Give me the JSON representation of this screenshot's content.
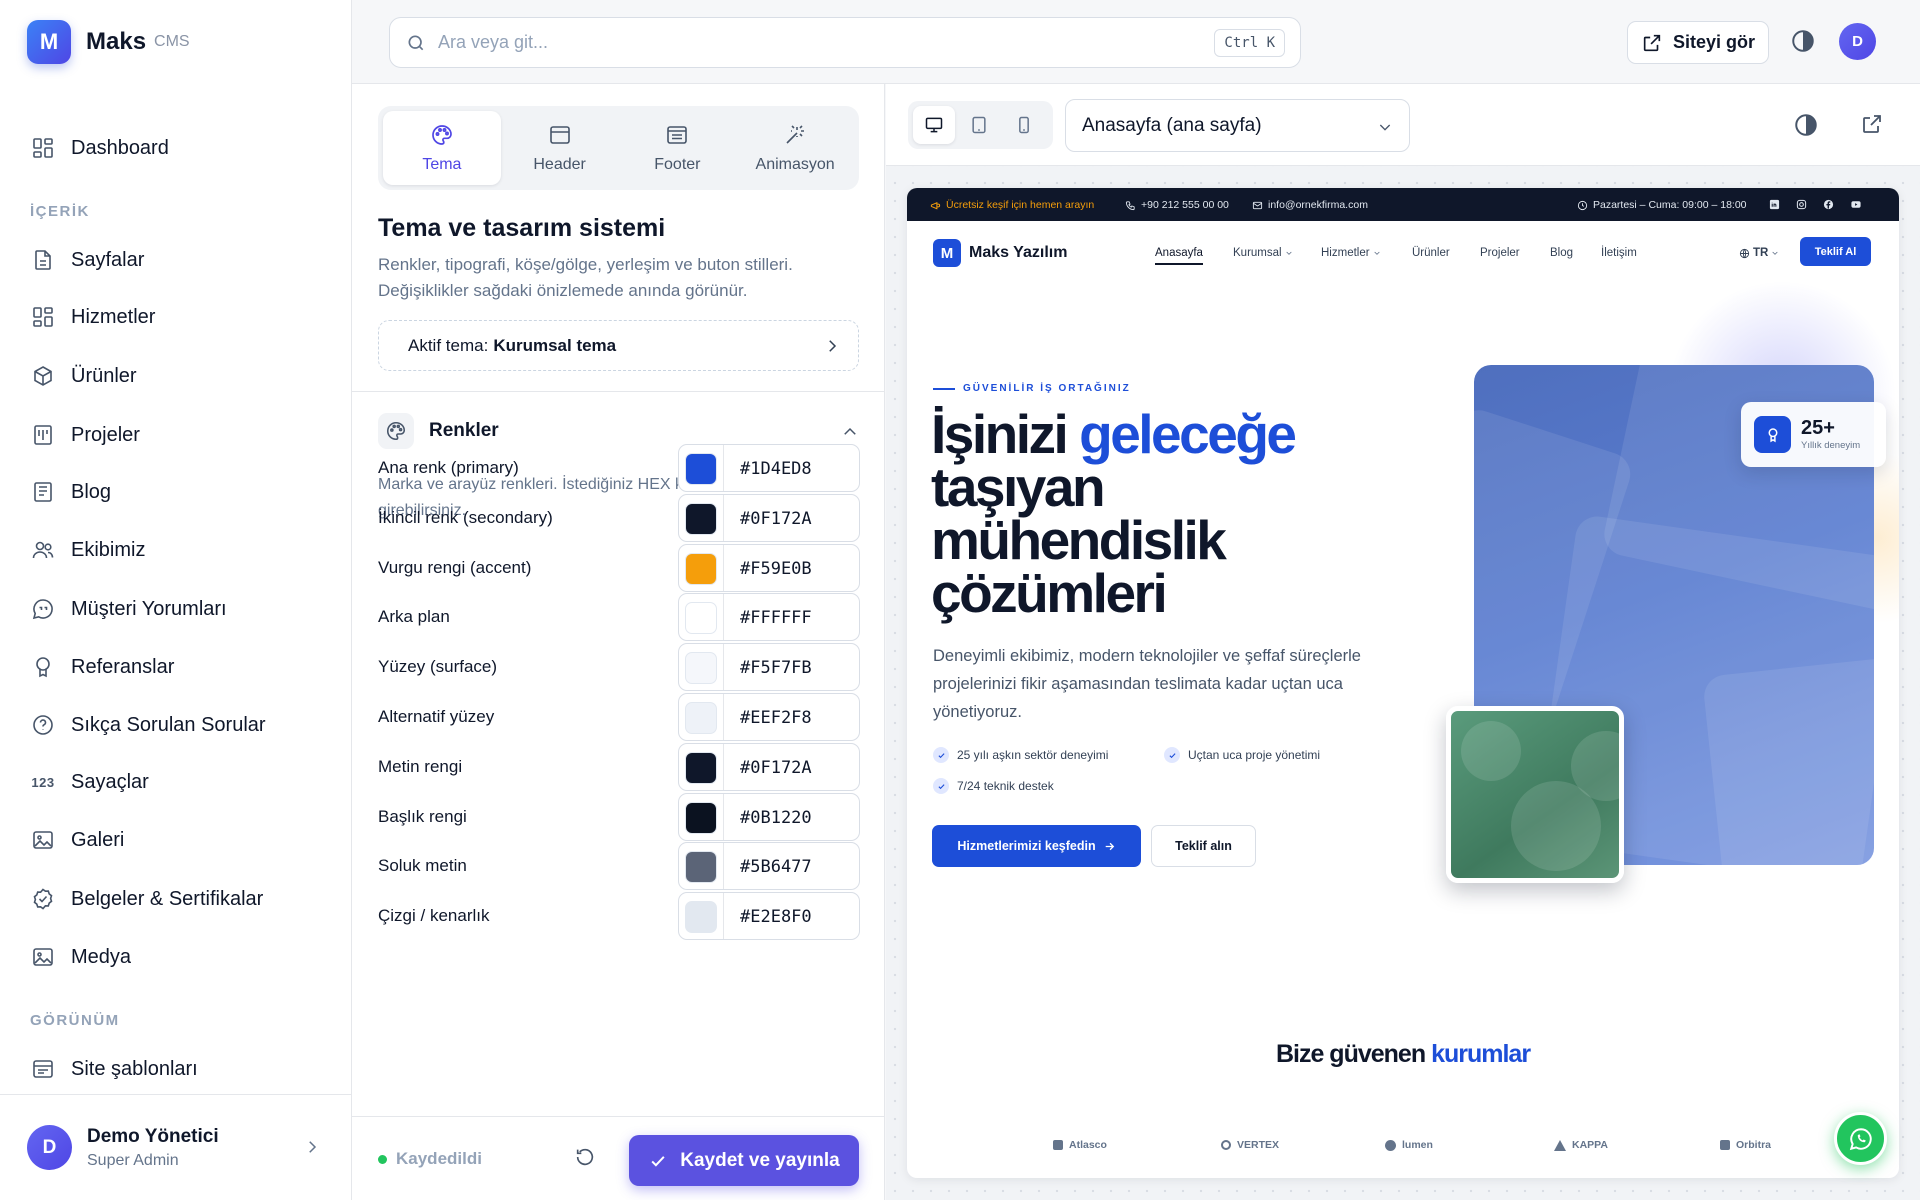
{
  "app": {
    "name": "Maks",
    "sub": "CMS",
    "logo_letter": "M"
  },
  "sidebar": {
    "dashboard": "Dashboard",
    "section_content": "İÇERİK",
    "items": [
      {
        "label": "Sayfalar",
        "icon": "file-icon"
      },
      {
        "label": "Hizmetler",
        "icon": "grid-icon"
      },
      {
        "label": "Ürünler",
        "icon": "box-icon"
      },
      {
        "label": "Projeler",
        "icon": "kanban-icon"
      },
      {
        "label": "Blog",
        "icon": "newspaper-icon"
      },
      {
        "label": "Ekibimiz",
        "icon": "users-icon"
      },
      {
        "label": "Müşteri Yorumları",
        "icon": "chat-icon"
      },
      {
        "label": "Referanslar",
        "icon": "award-icon"
      },
      {
        "label": "Sıkça Sorulan Sorular",
        "icon": "help-icon"
      },
      {
        "label": "Sayaçlar",
        "icon_text": "123"
      },
      {
        "label": "Galeri",
        "icon": "image-icon"
      },
      {
        "label": "Belgeler & Sertifikalar",
        "icon": "badge-check-icon"
      },
      {
        "label": "Medya",
        "icon": "images-icon"
      }
    ],
    "section_view": "GÖRÜNÜM",
    "templates": "Site şablonları",
    "user": {
      "initial": "D",
      "name": "Demo Yönetici",
      "role": "Super Admin"
    }
  },
  "topbar": {
    "search_placeholder": "Ara veya git...",
    "shortcut": "Ctrl K",
    "view_site": "Siteyi gör",
    "avatar": "D"
  },
  "editor": {
    "tabs": [
      {
        "label": "Tema",
        "active": true
      },
      {
        "label": "Header"
      },
      {
        "label": "Footer"
      },
      {
        "label": "Animasyon"
      }
    ],
    "title": "Tema ve tasarım sistemi",
    "description": "Renkler, tipografi, köşe/gölge, yerleşim ve buton stilleri. Değişiklikler sağdaki önizlemede anında görünür.",
    "active_theme_prefix": "Aktif tema:",
    "active_theme_name": "Kurumsal tema",
    "colors_section": {
      "title": "Renkler",
      "description": "Marka ve arayüz renkleri. İstediğiniz HEX kodunu girebilirsiniz.",
      "rows": [
        {
          "label": "Ana renk (primary)",
          "hex": "#1D4ED8"
        },
        {
          "label": "İkincil renk (secondary)",
          "hex": "#0F172A"
        },
        {
          "label": "Vurgu rengi (accent)",
          "hex": "#F59E0B"
        },
        {
          "label": "Arka plan",
          "hex": "#FFFFFF"
        },
        {
          "label": "Yüzey (surface)",
          "hex": "#F5F7FB"
        },
        {
          "label": "Alternatif yüzey",
          "hex": "#EEF2F8"
        },
        {
          "label": "Metin rengi",
          "hex": "#0F172A"
        },
        {
          "label": "Başlık rengi",
          "hex": "#0B1220"
        },
        {
          "label": "Soluk metin",
          "hex": "#5B6477"
        },
        {
          "label": "Çizgi / kenarlık",
          "hex": "#E2E8F0"
        }
      ]
    },
    "saved_status": "Kaydedildi",
    "publish_button": "Kaydet ve yayınla"
  },
  "preview": {
    "page_select": "Anasayfa (ana sayfa)",
    "site": {
      "topbar": {
        "promo": "Ücretsiz keşif için hemen arayın",
        "phone": "+90 212 555 00 00",
        "email": "info@ornekfirma.com",
        "hours": "Pazartesi – Cuma: 09:00 – 18:00"
      },
      "logo_letter": "M",
      "name": "Maks Yazılım",
      "nav": [
        "Anasayfa",
        "Kurumsal",
        "Hizmetler",
        "Ürünler",
        "Projeler",
        "Blog",
        "İletişim"
      ],
      "lang": "TR",
      "cta": "Teklif Al",
      "eyebrow": "GÜVENİLİR İŞ ORTAĞINIZ",
      "hero_title_1": "İşinizi",
      "hero_title_accent": "geleceğe",
      "hero_title_2": "taşıyan",
      "hero_title_3": "mühendislik",
      "hero_title_4": "çözümleri",
      "hero_text": "Deneyimli ekibimiz, modern teknolojiler ve şeffaf süreçlerle projelerinizi fikir aşamasından teslimata kadar uçtan uca yönetiyoruz.",
      "bullets": [
        "25 yılı aşkın sektör deneyimi",
        "Uçtan uca proje yönetimi",
        "7/24 teknik destek"
      ],
      "btn_primary": "Hizmetlerimizi keşfedin",
      "btn_secondary": "Teklif alın",
      "stat_number": "25+",
      "stat_label": "Yıllık deneyim",
      "trust_title": "Bize güvenen",
      "trust_accent": "kurumlar",
      "brands": [
        "Atlasco",
        "VERTEX",
        "lumen",
        "KAPPA",
        "Orbitra"
      ]
    }
  }
}
